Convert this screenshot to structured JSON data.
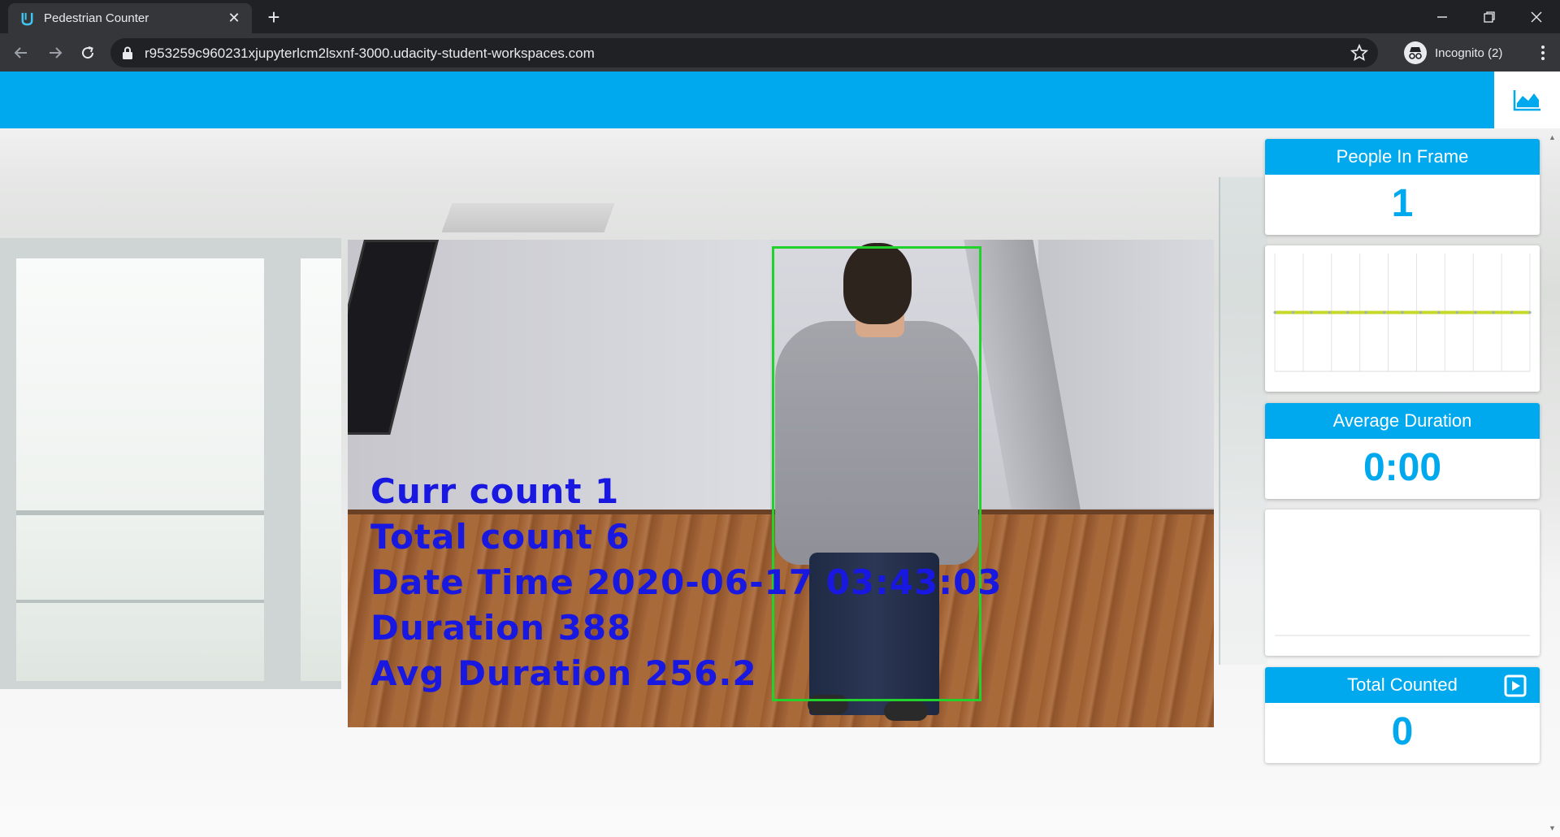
{
  "browser": {
    "tab_title": "Pedestrian Counter",
    "url": "r953259c960231xjupyterlcm2lsxnf-3000.udacity-student-workspaces.com",
    "profile_label": "Incognito (2)"
  },
  "colors": {
    "brand": "#00a9ee",
    "bbox": "#22d12b",
    "overlay_text": "#1818e0",
    "chart_line": "#c6d82a"
  },
  "video": {
    "overlay": [
      "Curr count 1",
      "Total count 6",
      "Date Time 2020-06-17 03:43:03",
      "Duration 388",
      "Avg Duration 256.2"
    ]
  },
  "sidebar": {
    "people_in_frame": {
      "title": "People In Frame",
      "value": "1"
    },
    "average_duration": {
      "title": "Average Duration",
      "value": "0:00"
    },
    "total_counted": {
      "title": "Total Counted",
      "value": "0"
    }
  },
  "icons": {
    "header_side": "area-chart-icon",
    "total_counted_action": "play-icon"
  },
  "chart_data": [
    {
      "type": "line",
      "series": [
        {
          "values": [
            1,
            1,
            1,
            1,
            1,
            1,
            1,
            1,
            1,
            1,
            1,
            1,
            1,
            1,
            1
          ]
        }
      ],
      "grid": true,
      "legend": "none"
    },
    {
      "type": "line",
      "series": [],
      "grid": false,
      "legend": "none"
    }
  ]
}
